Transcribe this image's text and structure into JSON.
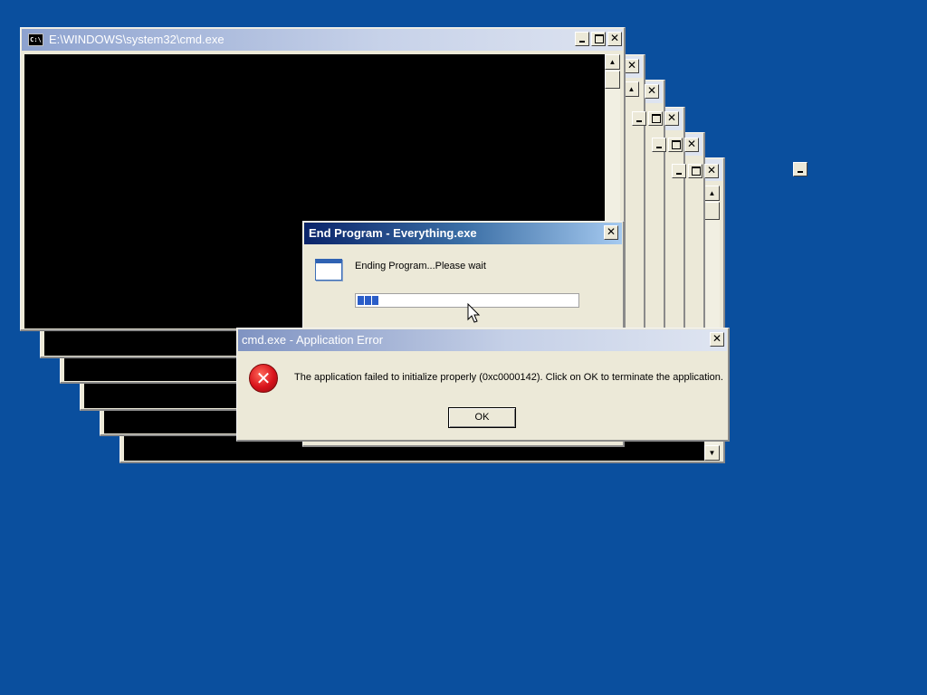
{
  "cmd_window": {
    "title": "E:\\WINDOWS\\system32\\cmd.exe",
    "icon_text": "C:\\"
  },
  "end_program_dialog": {
    "title": "End Program - Everything.exe",
    "message": "Ending Program...Please wait",
    "progress_fraction": 0.1
  },
  "error_dialog": {
    "title": "cmd.exe - Application Error",
    "message": "The application failed to initialize properly (0xc0000142). Click on OK to terminate the application.",
    "ok_label": "OK"
  },
  "colors": {
    "desktop": "#0a4f9e",
    "active_title": "#0a246a",
    "error_icon": "#d8121b",
    "progress": "#2a5dc8"
  },
  "icons": {
    "window_close": "close-icon",
    "window_minimize": "minimize-icon",
    "window_maximize": "maximize-icon",
    "error": "error-x-icon",
    "program": "window-icon",
    "cursor": "mouse-cursor-icon"
  }
}
